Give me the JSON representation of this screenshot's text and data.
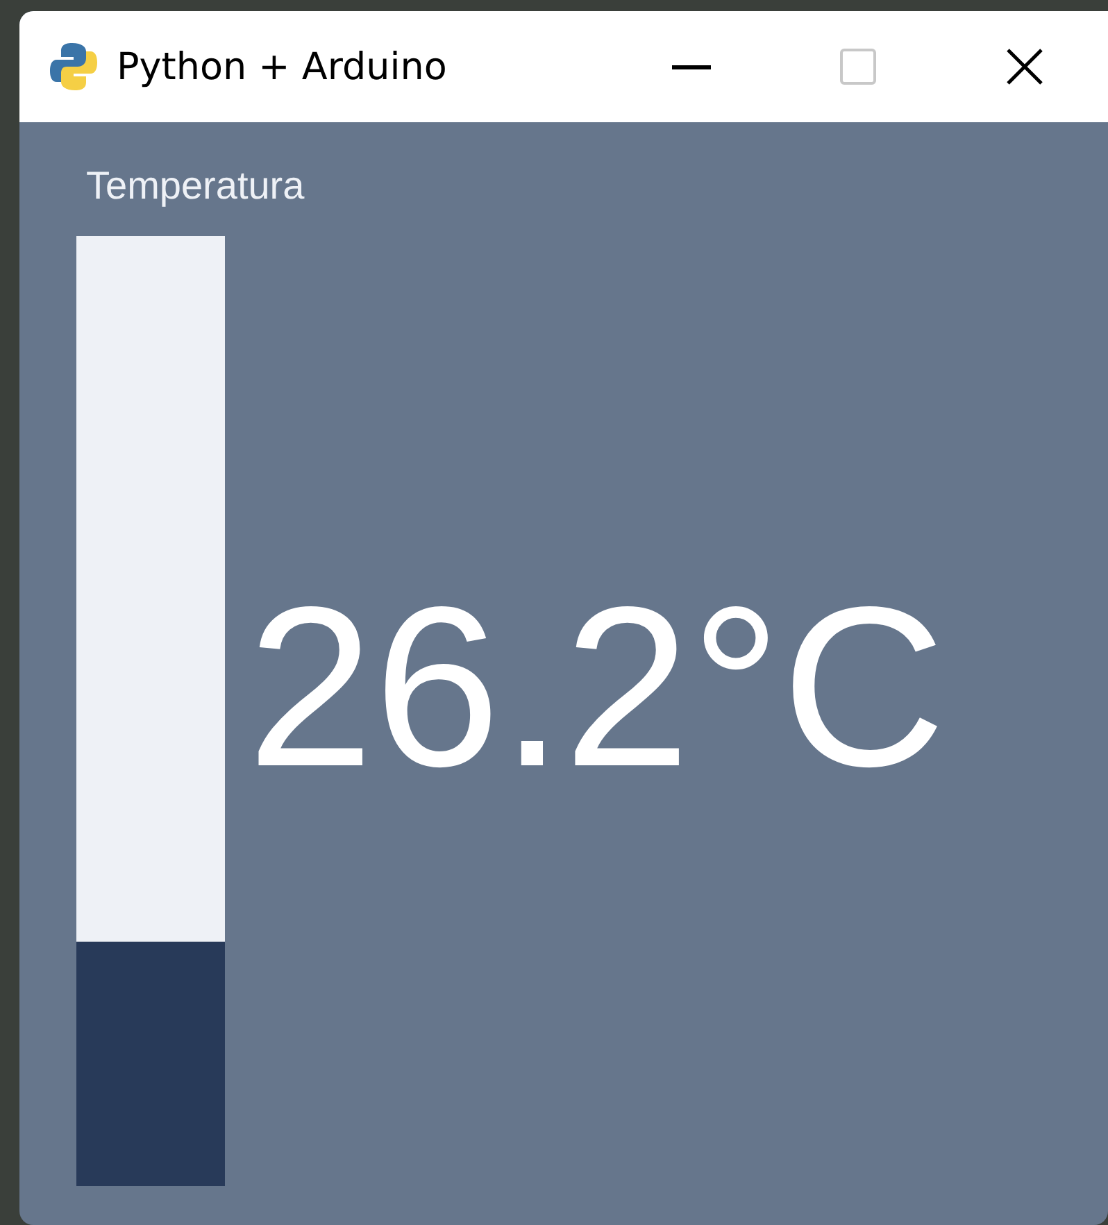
{
  "window": {
    "title": "Python + Arduino"
  },
  "gauge": {
    "label": "Temperatura",
    "level": 0.257,
    "reading": "26.2°C"
  }
}
